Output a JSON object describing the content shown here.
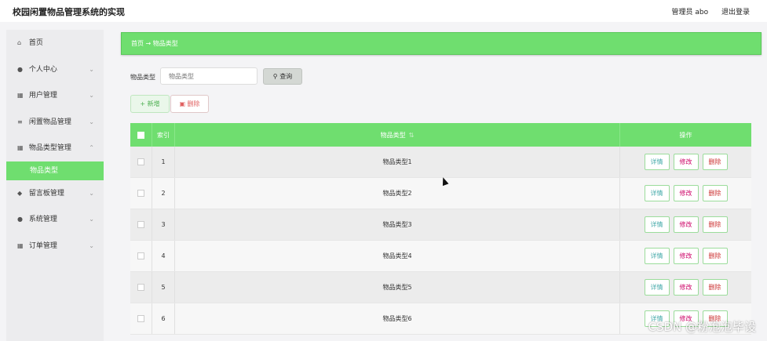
{
  "app": {
    "title": "校园闲置物品管理系统的实现",
    "admin": "管理员 abo",
    "logout": "退出登录"
  },
  "sidebar": {
    "items": [
      {
        "icon": "home-icon",
        "glyph": "⌂",
        "label": "首页",
        "chevron": false
      },
      {
        "icon": "user-icon",
        "glyph": "●",
        "label": "个人中心",
        "chevron": true
      },
      {
        "icon": "grid-icon",
        "glyph": "▦",
        "label": "用户管理",
        "chevron": true
      },
      {
        "icon": "list-icon",
        "glyph": "≡",
        "label": "闲置物品管理",
        "chevron": true
      },
      {
        "icon": "grid-icon",
        "glyph": "▦",
        "label": "物品类型管理",
        "chevron": true
      },
      {
        "icon": "chat-icon",
        "glyph": "◆",
        "label": "留言板管理",
        "chevron": true
      },
      {
        "icon": "user-icon",
        "glyph": "●",
        "label": "系统管理",
        "chevron": true
      },
      {
        "icon": "grid-icon",
        "glyph": "▦",
        "label": "订单管理",
        "chevron": true
      }
    ],
    "active_sub": "物品类型"
  },
  "breadcrumb": {
    "home": "首页",
    "sep": "→",
    "current": "物品类型"
  },
  "search": {
    "label": "物品类型",
    "placeholder": "物品类型",
    "query_btn": "查询",
    "add_btn": "新增",
    "delete_btn": "删除"
  },
  "table": {
    "columns": {
      "index": "索引",
      "name": "物品类型",
      "ops": "操作"
    },
    "rows": [
      {
        "index": "1",
        "name": "物品类型1"
      },
      {
        "index": "2",
        "name": "物品类型2"
      },
      {
        "index": "3",
        "name": "物品类型3"
      },
      {
        "index": "4",
        "name": "物品类型4"
      },
      {
        "index": "5",
        "name": "物品类型5"
      },
      {
        "index": "6",
        "name": "物品类型6"
      }
    ],
    "op_labels": {
      "detail": "详情",
      "edit": "修改",
      "delete": "删除"
    }
  },
  "colors": {
    "accent": "#6fde6f"
  },
  "watermark": "CSDN @粉泡泡毕设"
}
